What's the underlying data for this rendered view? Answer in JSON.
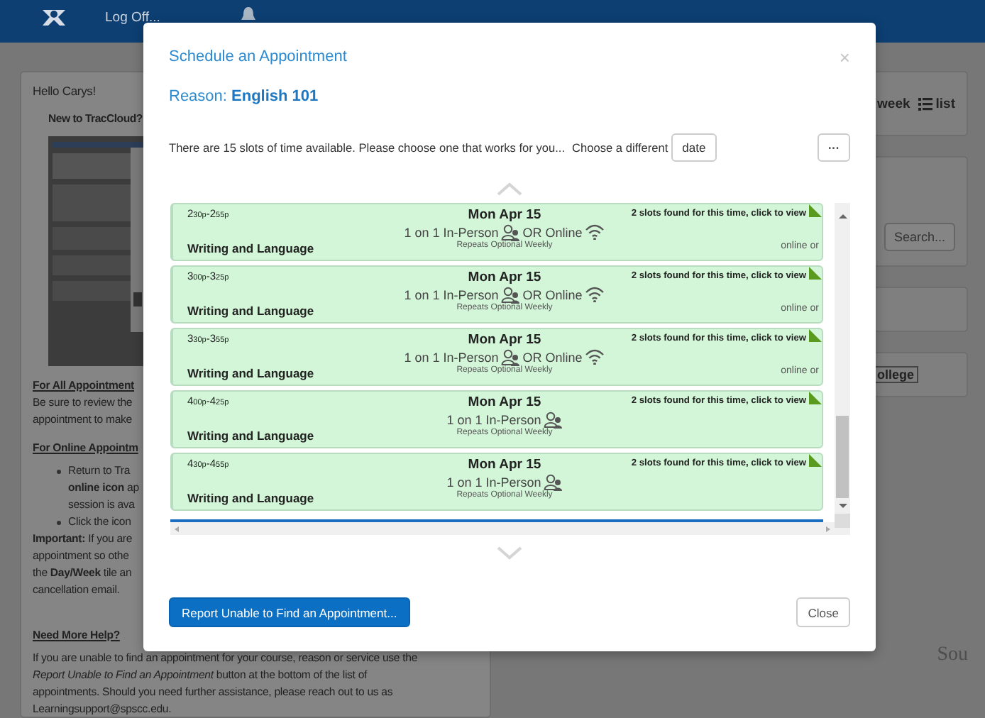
{
  "top_bar": {
    "log_off": "Log Off..."
  },
  "left_panel": {
    "greeting": "Hello Carys!",
    "heading": "New to TracCloud?",
    "blocks": [
      {
        "kind": "heading",
        "text": "For All Appointment"
      },
      {
        "kind": "para",
        "lines": [
          "Be sure to review the",
          "appointment to make"
        ]
      },
      {
        "kind": "heading",
        "text": "For Online Appointm"
      },
      {
        "kind": "bullets",
        "items": [
          {
            "lines": [
              "Return to Tra",
              "**online icon** ap",
              "session is ava"
            ]
          },
          {
            "lines": [
              "Click the icon"
            ]
          }
        ]
      },
      {
        "kind": "para",
        "lines": [
          "**Important:** If you are",
          "appointment so othe",
          "the **Day/Week** tile an",
          "cancellation email."
        ]
      },
      {
        "kind": "heading",
        "text": "Need More Help?"
      },
      {
        "kind": "para",
        "lines": [
          "If you are unable to find an appointment for your course, reason or service use the",
          "*Report Unable to Find an Appointment* button at the bottom of the list of",
          "appointments. Should you need further assistance, please reach out to us as",
          "Learningsupport@spscc.edu."
        ]
      }
    ]
  },
  "right_panels": {
    "week": "week",
    "list": "list",
    "search_button": "Search...",
    "tag": "ollege",
    "footer_text": "Sou"
  },
  "modal": {
    "title": "Schedule an Appointment",
    "close": "×",
    "reason": "Reason: **English 101**",
    "info": "There are 15 slots of time available. Please choose one that works for you...",
    "choose_label": "Choose a different",
    "date_button": "date",
    "more_button": "···",
    "slots": [
      {
        "kind": "hybrid",
        "time": "2$_{30p}$-2$_{55p}$",
        "date": "Mon Apr 15",
        "mode": "1 on 1 In-Person",
        "online": "OR Online",
        "found": "2 slots found for this time, click to view",
        "subject": "Writing and Language",
        "repeats": "Repeats Optional Weekly",
        "location": "online or"
      },
      {
        "kind": "hybrid",
        "time": "3$_{00p}$-3$_{25p}$",
        "date": "Mon Apr 15",
        "mode": "1 on 1 In-Person",
        "online": "OR Online",
        "found": "2 slots found for this time, click to view",
        "subject": "Writing and Language",
        "repeats": "Repeats Optional Weekly",
        "location": "online or"
      },
      {
        "kind": "hybrid",
        "time": "3$_{30p}$-3$_{55p}$",
        "date": "Mon Apr 15",
        "mode": "1 on 1 In-Person",
        "online": "OR Online",
        "found": "2 slots found for this time, click to view",
        "subject": "Writing and Language",
        "repeats": "Repeats Optional Weekly",
        "location": "online or"
      },
      {
        "kind": "in_person",
        "time": "4$_{00p}$-4$_{25p}$",
        "date": "Mon Apr 15",
        "mode": "1 on 1 In-Person",
        "found": "2 slots found for this time, click to view",
        "subject": "Writing and Language",
        "repeats": "Repeats Optional Weekly"
      },
      {
        "kind": "in_person",
        "time": "4$_{30p}$-4$_{55p}$",
        "date": "Mon Apr 15",
        "mode": "1 on 1 In-Person",
        "found": "2 slots found for this time, click to view",
        "subject": "Writing and Language",
        "repeats": "Repeats Optional Weekly"
      }
    ],
    "report_button": "Report Unable to Find an Appointment...",
    "close_button": "Close"
  }
}
